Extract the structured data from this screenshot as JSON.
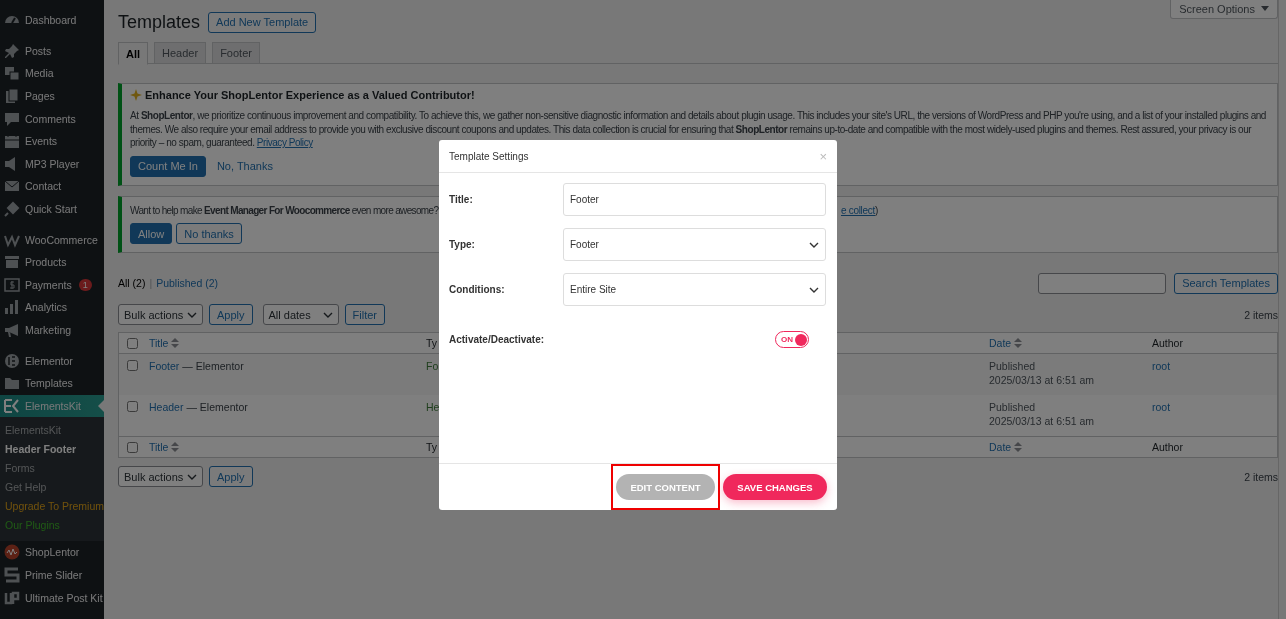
{
  "sidebar": {
    "groups": [
      {
        "items": [
          {
            "label": "Dashboard",
            "selected": false
          }
        ]
      },
      {
        "items": [
          {
            "label": "Posts",
            "selected": false
          },
          {
            "label": "Media",
            "selected": false
          },
          {
            "label": "Pages",
            "selected": false
          },
          {
            "label": "Comments",
            "selected": false
          },
          {
            "label": "Events",
            "selected": false
          },
          {
            "label": "MP3 Player",
            "selected": false
          },
          {
            "label": "Contact",
            "selected": false
          },
          {
            "label": "Quick Start",
            "selected": false
          }
        ]
      },
      {
        "items": [
          {
            "label": "WooCommerce",
            "selected": false
          },
          {
            "label": "Products",
            "selected": false
          },
          {
            "label": "Payments",
            "selected": false,
            "badge": "1"
          },
          {
            "label": "Analytics",
            "selected": false
          },
          {
            "label": "Marketing",
            "selected": false
          }
        ]
      },
      {
        "items": [
          {
            "label": "Elementor",
            "selected": false
          },
          {
            "label": "Templates",
            "selected": false
          },
          {
            "label": "ElementsKit",
            "selected": true,
            "expanded": true,
            "children": [
              {
                "label": "ElementsKit",
                "selected": false,
                "kind": "normal"
              },
              {
                "label": "Header Footer",
                "selected": true,
                "kind": "normal"
              },
              {
                "label": "Forms",
                "selected": false,
                "kind": "normal"
              },
              {
                "label": "Get Help",
                "selected": false,
                "kind": "normal"
              },
              {
                "label": "Upgrade To Premium",
                "selected": false,
                "kind": "upgrade"
              },
              {
                "label": "Our Plugins",
                "selected": false,
                "kind": "plugins"
              }
            ]
          },
          {
            "label": "ShopLentor",
            "selected": false
          },
          {
            "label": "Prime Slider",
            "selected": false
          },
          {
            "label": "Ultimate Post Kit",
            "selected": false
          }
        ]
      }
    ]
  },
  "screen_options": {
    "label": "Screen Options"
  },
  "page": {
    "title": "Templates",
    "add_button": "Add New Template"
  },
  "tabs": [
    {
      "label": "All",
      "selected": true
    },
    {
      "label": "Header",
      "selected": false
    },
    {
      "label": "Footer",
      "selected": false
    }
  ],
  "notices": [
    {
      "kind": "contributor",
      "title": "Enhance Your ShopLentor Experience as a Valued Contributor!",
      "text": "At **ShopLentor**, we prioritize continuous improvement and compatibility. To achieve this, we gather non-sensitive diagnostic information and details about plugin usage. This includes your site's URL, the versions of WordPress and PHP you're using, and a list of your installed plugins and themes. We also require your email address to provide you with exclusive discount coupons and updates. This data collection is crucial for ensuring that **ShopLentor** remains up-to-date and compatible with the most widely-used plugins and themes. Rest assured, your privacy is our priority – no spam, guaranteed.",
      "link": "Privacy Policy",
      "buttons": [
        {
          "label": "Count Me In",
          "kind": "primary"
        },
        {
          "label": "No, Thanks",
          "kind": "link"
        }
      ]
    },
    {
      "kind": "optin",
      "text": "Want to help make **Event Manager For Woocommerce** even more awesome?",
      "tail_link": "e collect",
      "tail_text": ")",
      "buttons": [
        {
          "label": "Allow",
          "kind": "primary"
        },
        {
          "label": "No thanks",
          "kind": "secondary"
        }
      ]
    }
  ],
  "views": [
    {
      "label": "All",
      "count": "(2)",
      "selected": true
    },
    {
      "label": "Published",
      "count": "(2)",
      "selected": false
    }
  ],
  "views_separator": "|",
  "search_button": "Search Templates",
  "top_actions": {
    "bulk": "Bulk actions",
    "apply": "Apply",
    "dates": "All dates",
    "filter": "Filter",
    "count": "2 items"
  },
  "table": {
    "select_all_checked": false,
    "footer_select_all_checked": false,
    "columns": [
      {
        "label": "Title",
        "sortable": true
      },
      {
        "label": "Ty",
        "sortable": false
      },
      {
        "label": "Date",
        "sortable": true
      },
      {
        "label": "Author",
        "sortable": false
      }
    ],
    "rows": [
      {
        "checked": false,
        "title": "Footer",
        "suffix": "— Elementor",
        "type": "Fo",
        "status": "Published",
        "date": "2025/03/13 at 6:51 am",
        "author": "root"
      },
      {
        "checked": false,
        "title": "Header",
        "suffix": "— Elementor",
        "type": "He",
        "status": "Published",
        "date": "2025/03/13 at 6:51 am",
        "author": "root"
      }
    ],
    "footer_columns": [
      {
        "label": "Title",
        "sortable": true
      },
      {
        "label": "Ty",
        "sortable": false
      },
      {
        "label": "Date",
        "sortable": true
      },
      {
        "label": "Author",
        "sortable": false
      }
    ]
  },
  "bottom_actions": {
    "bulk": "Bulk actions",
    "apply": "Apply",
    "count": "2 items"
  },
  "modal": {
    "title": "Template Settings",
    "close": "×",
    "fields": [
      {
        "kind": "text",
        "label": "Title:",
        "value": "Footer"
      },
      {
        "kind": "select",
        "label": "Type:",
        "value": "Footer"
      },
      {
        "kind": "select",
        "label": "Conditions:",
        "value": "Entire Site"
      },
      {
        "kind": "toggle",
        "label": "Activate/Deactivate:",
        "on": true,
        "text": "ON"
      }
    ],
    "buttons": [
      {
        "label": "EDIT CONTENT",
        "kind": "secondary",
        "highlighted": true
      },
      {
        "label": "SAVE CHANGES",
        "kind": "primary",
        "highlighted": false
      }
    ]
  }
}
